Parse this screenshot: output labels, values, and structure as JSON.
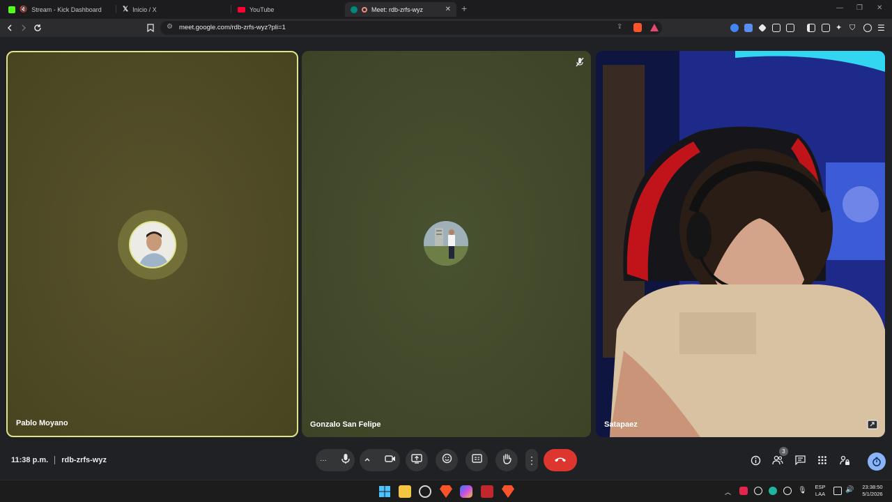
{
  "browser": {
    "tabs": [
      {
        "label": "Stream - Kick Dashboard",
        "favicon_color": "#53fc18"
      },
      {
        "label": "Inicio / X",
        "favicon_color": "#e8eaed"
      },
      {
        "label": "YouTube",
        "favicon_color": "#ff0033"
      },
      {
        "label": "Meet: rdb-zrfs-wyz",
        "favicon_color": "#00897b"
      }
    ],
    "active_tab_index": 3,
    "url": "meet.google.com/rdb-zrfs-wyz?pli=1"
  },
  "participants": [
    {
      "name": "Pablo Moyano",
      "speaking": true,
      "video": false
    },
    {
      "name": "Gonzalo San Felipe",
      "muted": true,
      "video": false
    },
    {
      "name": "Satapaez",
      "video": true
    }
  ],
  "meeting": {
    "time": "11:38 p.m.",
    "code": "rdb-zrfs-wyz",
    "participant_count": "3"
  },
  "taskbar": {
    "lang_top": "ESP",
    "lang_bottom": "LAA",
    "clock_time": "23:38:50",
    "clock_date": "5/1/2026"
  },
  "colors": {
    "accent_speaking": "#dfe58a",
    "hangup": "#dc362e",
    "control_bg": "#333537"
  }
}
